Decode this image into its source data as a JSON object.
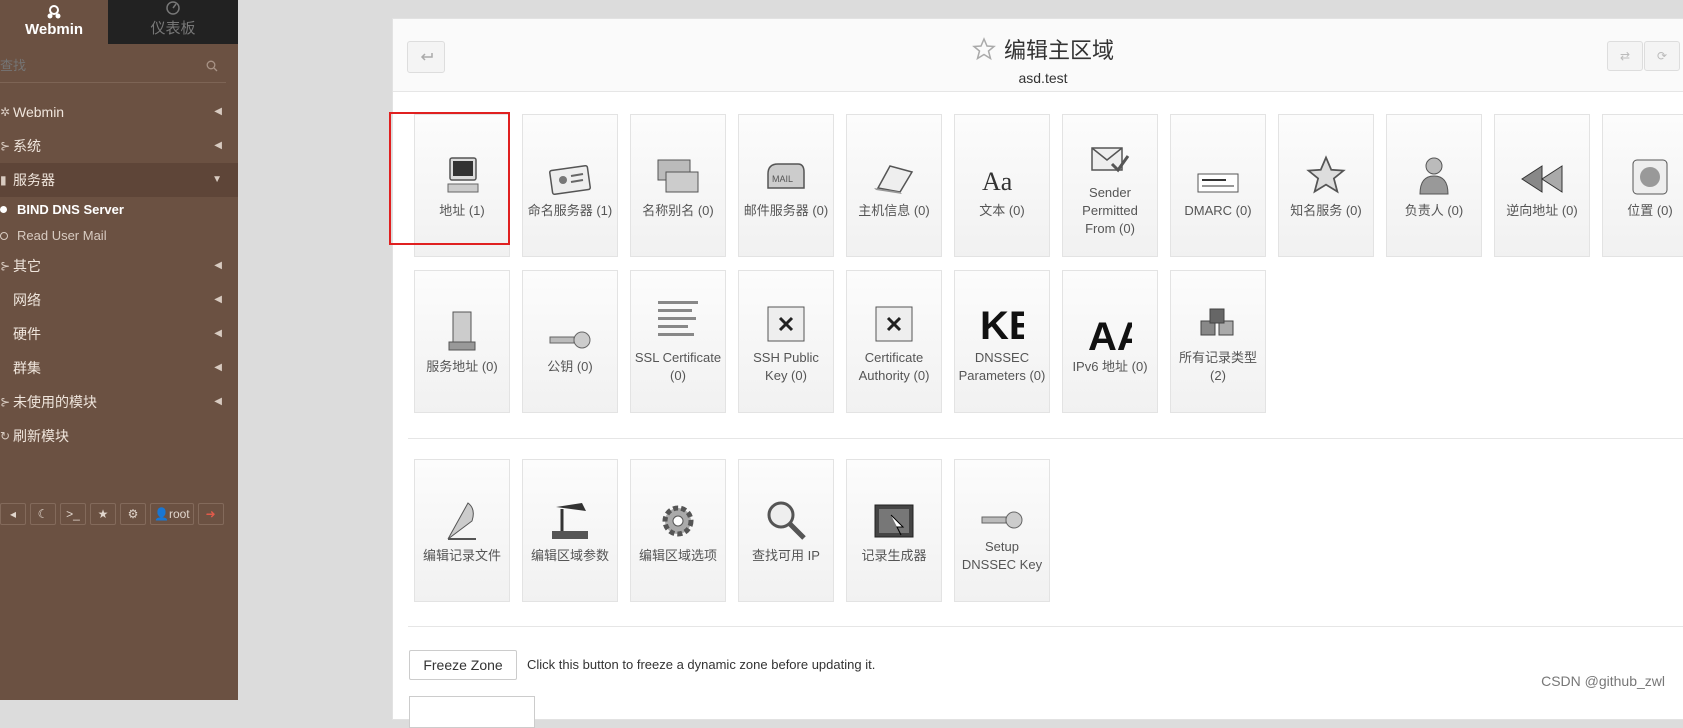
{
  "sidebar": {
    "tabs": [
      {
        "label": "Webmin",
        "icon": "webmin-logo-icon"
      },
      {
        "label": "仪表板",
        "icon": "dashboard-icon"
      }
    ],
    "search_placeholder": "查找",
    "menu": [
      {
        "label": "Webmin"
      },
      {
        "label": "系统"
      },
      {
        "label": "服务器"
      },
      {
        "label": "其它"
      },
      {
        "label": "网络"
      },
      {
        "label": "硬件"
      },
      {
        "label": "群集"
      },
      {
        "label": "未使用的模块"
      },
      {
        "label": "刷新模块"
      }
    ],
    "sub_items": [
      {
        "label": "BIND DNS Server",
        "active": true
      },
      {
        "label": "Read User Mail",
        "active": false
      }
    ],
    "footer_user": "root"
  },
  "header": {
    "title": "编辑主区域",
    "subtitle": "asd.test"
  },
  "records_row1": [
    {
      "label": "地址 (1)",
      "icon": "computer-icon"
    },
    {
      "label": "命名服务器 (1)",
      "icon": "id-card-icon"
    },
    {
      "label": "名称别名 (0)",
      "icon": "windows-stack-icon"
    },
    {
      "label": "邮件服务器 (0)",
      "icon": "mailbox-icon"
    },
    {
      "label": "主机信息 (0)",
      "icon": "laptop-icon"
    },
    {
      "label": "文本 (0)",
      "icon": "text-aa-icon"
    },
    {
      "label": "Sender Permitted From (0)",
      "icon": "mail-check-icon"
    },
    {
      "label": "DMARC (0)",
      "icon": "dmarc-card-icon"
    },
    {
      "label": "知名服务 (0)",
      "icon": "star-icon"
    },
    {
      "label": "负责人 (0)",
      "icon": "person-icon"
    },
    {
      "label": "逆向地址 (0)",
      "icon": "rewind-arrows-icon"
    },
    {
      "label": "位置 (0)",
      "icon": "globe-icon"
    }
  ],
  "records_row2": [
    {
      "label": "服务地址 (0)",
      "icon": "server-tower-icon"
    },
    {
      "label": "公钥 (0)",
      "icon": "key-icon"
    },
    {
      "label": "SSL Certificate (0)",
      "icon": "ssl-text-icon"
    },
    {
      "label": "SSH Public Key (0)",
      "icon": "image-not-found-icon"
    },
    {
      "label": "Certificate Authority (0)",
      "icon": "image-not-found-icon"
    },
    {
      "label": "DNSSEC Parameters (0)",
      "icon": "ke-letters-icon"
    },
    {
      "label": "IPv6 地址 (0)",
      "icon": "aa-letters-icon"
    },
    {
      "label": "所有记录类型 (2)",
      "icon": "cubes-icon"
    }
  ],
  "actions": [
    {
      "label": "编辑记录文件",
      "icon": "feather-pen-icon"
    },
    {
      "label": "编辑区域参数",
      "icon": "desk-lamp-icon"
    },
    {
      "label": "编辑区域选项",
      "icon": "gear-icon"
    },
    {
      "label": "查找可用 IP",
      "icon": "magnifier-icon"
    },
    {
      "label": "记录生成器",
      "icon": "generator-icon"
    },
    {
      "label": "Setup DNSSEC Key",
      "icon": "dnssec-key-icon"
    }
  ],
  "freeze": {
    "button_label": "Freeze Zone",
    "description": "Click this button to freeze a dynamic zone before updating it."
  },
  "watermark": "CSDN @github_zwl",
  "colors": {
    "sidebar_bg": "#6b5142",
    "highlight_border": "#e02020"
  }
}
